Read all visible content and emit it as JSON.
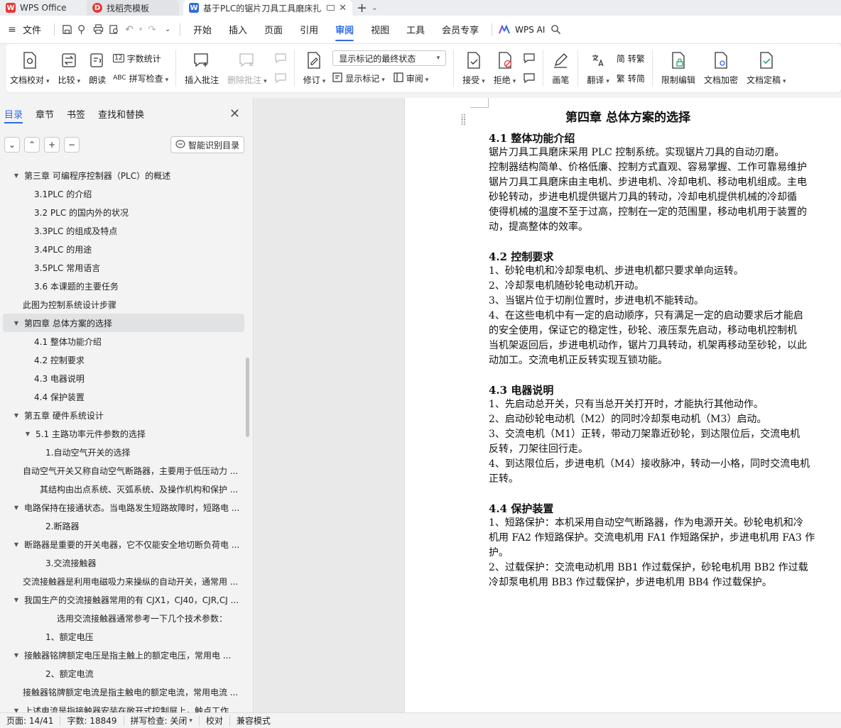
{
  "titlebar": {
    "tabs": [
      {
        "label": "WPS Office"
      },
      {
        "label": "找稻壳模板"
      },
      {
        "label": "基于PLC的锯片刀具工具磨床扎"
      }
    ]
  },
  "menubar": {
    "file": "文件",
    "items": [
      "开始",
      "插入",
      "页面",
      "引用",
      "审阅",
      "视图",
      "工具",
      "会员专享"
    ],
    "active": "审阅",
    "ai": "WPS AI"
  },
  "ribbon": {
    "doc_check": "文档校对",
    "compare": "比较",
    "read_aloud": "朗读",
    "word_count": "字数统计",
    "spell_check": "拼写检查",
    "insert_comment": "插入批注",
    "delete_comment": "删除批注",
    "revise": "修订",
    "markup_select": "显示标记的最终状态",
    "show_markup": "显示标记",
    "review": "审阅",
    "accept": "接受",
    "reject": "拒绝",
    "ink": "画笔",
    "translate": "翻译",
    "to_traditional": "转繁",
    "to_simplified": "转简",
    "restrict_edit": "限制编辑",
    "encrypt": "文档加密",
    "finalize": "文档定稿"
  },
  "nav": {
    "tabs": [
      "目录",
      "章节",
      "书签",
      "查找和替换"
    ],
    "smart_toc": "智能识别目录",
    "toc": [
      {
        "text": "第三章 可编程序控制器（PLC）的概述",
        "level": 1,
        "caret": "open"
      },
      {
        "text": "3.1PLC 的介绍",
        "level": 2
      },
      {
        "text": "3.2 PLC 的国内外的状况",
        "level": 2
      },
      {
        "text": "3.3PLC 的组成及特点",
        "level": 2
      },
      {
        "text": "3.4PLC 的用途",
        "level": 2
      },
      {
        "text": "3.5PLC 常用语言",
        "level": 2
      },
      {
        "text": "3.6 本课题的主要任务",
        "level": 2
      },
      {
        "text": "此图为控制系统设计步骤",
        "level": 1
      },
      {
        "text": "第四章  总体方案的选择",
        "level": 1,
        "caret": "open",
        "selected": true
      },
      {
        "text": "4.1 整体功能介绍",
        "level": 2
      },
      {
        "text": "4.2 控制要求",
        "level": 2
      },
      {
        "text": "4.3 电器说明",
        "level": 2
      },
      {
        "text": "4.4 保护装置",
        "level": 2
      },
      {
        "text": "第五章   硬件系统设计",
        "level": 1,
        "caret": "open"
      },
      {
        "text": "5.1 主路功率元件参数的选择",
        "level": 2,
        "caret": "open"
      },
      {
        "text": "1.自动空气开关的选择",
        "level": 3
      },
      {
        "text": "自动空气开关又称自动空气断路器，主要用于低压动力 ...",
        "level": 1
      },
      {
        "text": "其结构由出点系统、灭弧系统、及操作机构和保护 ...",
        "level": 2.5
      },
      {
        "text": "电路保持在接通状态。当电路发生短路故障时，短路电 ...",
        "level": 1,
        "caret": "open"
      },
      {
        "text": "2.断路器",
        "level": 3
      },
      {
        "text": "断路器是重要的开关电器，它不仅能安全地切断负荷电 ...",
        "level": 1,
        "caret": "open"
      },
      {
        "text": "3.交流接触器",
        "level": 3
      },
      {
        "text": "交流接触器是利用电磁吸力来操纵的自动开关，通常用 ...",
        "level": 1
      },
      {
        "text": "我国生产的交流接触器常用的有 CJX1，CJ40，CJR,CJ ...",
        "level": 1,
        "caret": "open"
      },
      {
        "text": "选用交流接触器通常参考一下几个技术参数：",
        "level": 3.5
      },
      {
        "text": "1、额定电压",
        "level": 3
      },
      {
        "text": "接触器铭牌额定电压是指主触上的额定电压，常用电 ...",
        "level": 1,
        "caret": "open"
      },
      {
        "text": "2、额定电流",
        "level": 3
      },
      {
        "text": "接触器铭牌额定电流是指主触电的额定电流，常用电流 ...",
        "level": 1
      },
      {
        "text": "上述电流是指接触器安装在敞开式控制屏上，触点工作 ...",
        "level": 1,
        "caret": "open"
      }
    ]
  },
  "doc": {
    "title": "第四章  总体方案的选择",
    "s1": "4.1 整体功能介绍",
    "s1_lines": [
      "    锯片刀具工具磨床采用 PLC 控制系统。实现锯片刀具的自动刃磨。",
      "控制器结构简单、价格低廉、控制方式直观、容易掌握、工作可靠易维护",
      "锯片刀具工具磨床由主电机、步进电机、冷却电机、移动电机组成。主电",
      "砂轮转动，步进电机提供锯片刀具的转动，冷却电机提供机械的冷却循",
      "使得机械的温度不至于过高，控制在一定的范围里，移动电机用于装置的",
      "动，提高整体的效率。"
    ],
    "s2": "4.2 控制要求",
    "s2_lines": [
      "1、砂轮电机和冷却泵电机、步进电机都只要求单向运转。",
      "2、冷却泵电机随砂轮电动机开动。",
      "3、当锯片位于切削位置时，步进电机不能转动。",
      "4、在这些电机中有一定的启动顺序，只有满足一定的启动要求后才能启",
      "的安全使用，保证它的稳定性，砂轮、液压泵先启动，移动电机控制机",
      "当机架返回后，步进电机动作，锯片刀具转动，机架再移动至砂轮，以此",
      "动加工。交流电机正反转实现互锁功能。"
    ],
    "s3": "4.3 电器说明",
    "s3_lines": [
      "1、先启动总开关，只有当总开关打开时，才能执行其他动作。",
      "2、启动砂轮电动机（M2）的同时冷却泵电动机（M3）启动。",
      "3、交流电机（M1）正转，带动刀架靠近砂轮，到达限位后，交流电机",
      "反转，刀架往回行走。",
      "4、到达限位后，步进电机（M4）接收脉冲，转动一小格，同时交流电机",
      "正转。"
    ],
    "s4": "4.4 保护装置",
    "s4_lines": [
      "1、短路保护：本机采用自动空气断路器，作为电源开关。砂轮电机和冷",
      "机用 FA2 作短路保护。交流电机用 FA1 作短路保护，步进电机用 FA3 作",
      "护。",
      "2、过载保护：交流电动机用 BB1 作过载保护，砂轮电机用 BB2 作过载",
      "冷却泵电机用 BB3 作过载保护，步进电机用 BB4 作过载保护。"
    ]
  },
  "status": {
    "page": "页面: 14/41",
    "words": "字数: 18849",
    "spell": "拼写检查: 关闭",
    "proof": "校对",
    "compat": "兼容模式"
  },
  "colors": {
    "accent": "#2f6ce5",
    "wps_red": "#e53935"
  }
}
